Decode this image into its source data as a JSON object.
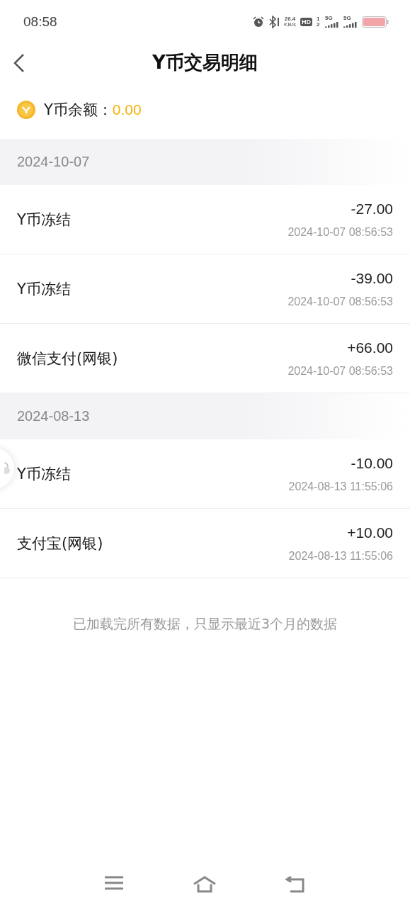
{
  "status_bar": {
    "time": "08:58",
    "net_speed": "26.4",
    "net_unit": "KB/s",
    "hd": "HD",
    "sim_slots": "1 2",
    "sim1": "5G",
    "sim2": "5G"
  },
  "header": {
    "title": "Y币交易明细"
  },
  "balance": {
    "label": "Y币余额：",
    "value": "0.00"
  },
  "groups": [
    {
      "date": "2024-10-07",
      "items": [
        {
          "title": "Y币冻结",
          "amount": "-27.00",
          "time": "2024-10-07 08:56:53"
        },
        {
          "title": "Y币冻结",
          "amount": "-39.00",
          "time": "2024-10-07 08:56:53"
        },
        {
          "title": "微信支付(网银)",
          "amount": "+66.00",
          "time": "2024-10-07 08:56:53"
        }
      ]
    },
    {
      "date": "2024-08-13",
      "items": [
        {
          "title": "Y币冻结",
          "amount": "-10.00",
          "time": "2024-08-13 11:55:06"
        },
        {
          "title": "支付宝(网银)",
          "amount": "+10.00",
          "time": "2024-08-13 11:55:06"
        }
      ]
    }
  ],
  "footer_note": "已加载完所有数据，只显示最近3个月的数据"
}
